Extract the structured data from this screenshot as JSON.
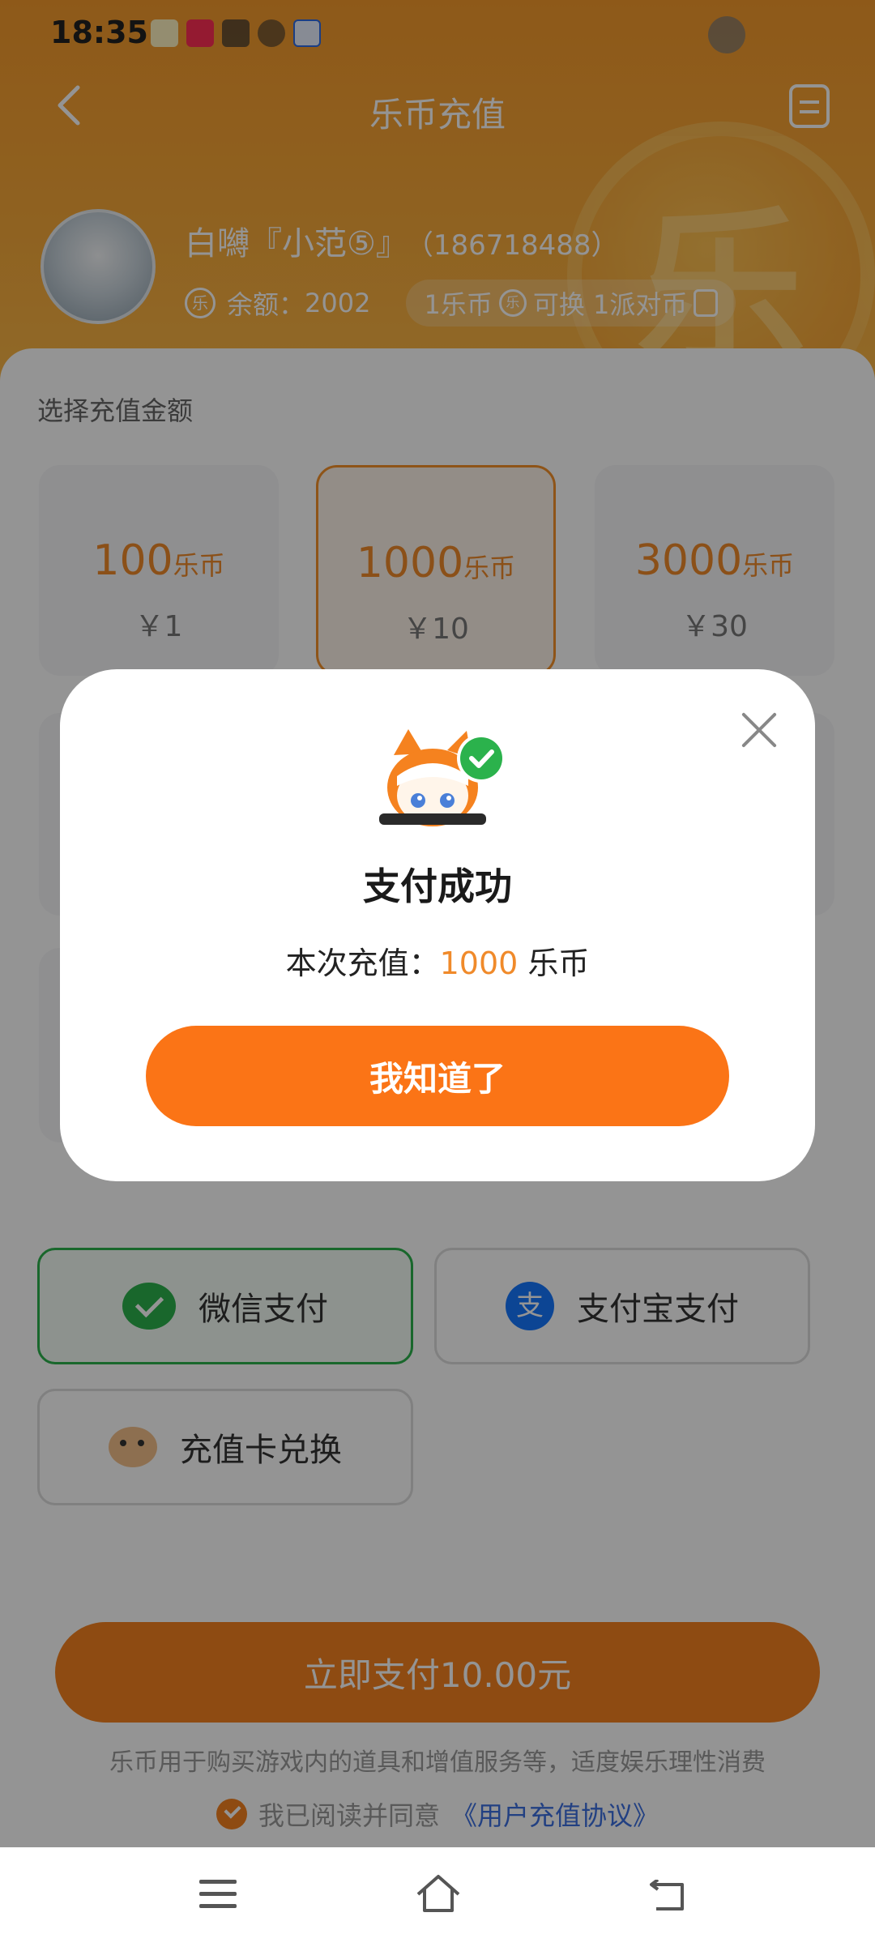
{
  "status_bar": {
    "time": "18:35",
    "app_icons": [
      "app-icon-1",
      "xiaohongshu-icon",
      "wallet-icon",
      "link-icon",
      "baidu-icon"
    ]
  },
  "header": {
    "title": "乐币充值",
    "coin_glyph": "乐",
    "username": "白嚩『小范⑤』",
    "user_id": "（186718488）",
    "balance_label": "余额：",
    "balance_value": "2002",
    "rate_text_a": "1乐币",
    "rate_text_b": "可换 1派对币",
    "colors": {
      "accent": "#f5912a",
      "pay_green": "#2bb24c",
      "alipay_blue": "#1677ff",
      "button_orange": "#fb7416"
    }
  },
  "recharge": {
    "section_label": "选择充值金额",
    "unit": "乐币",
    "options": [
      {
        "coins": "100",
        "price": "￥1"
      },
      {
        "coins": "1000",
        "price": "￥10",
        "selected": true
      },
      {
        "coins": "3000",
        "price": "￥30"
      }
    ]
  },
  "payment": {
    "wechat": "微信支付",
    "alipay": "支付宝支付",
    "alipay_glyph": "支",
    "card": "充值卡兑换"
  },
  "footer": {
    "pay_button": "立即支付10.00元",
    "notice": "乐币用于购买游戏内的道具和增值服务等，适度娱乐理性消费",
    "agree_text": "我已阅读并同意",
    "agreement_link": "《用户充值协议》"
  },
  "dialog": {
    "title": "支付成功",
    "msg_prefix": "本次充值：",
    "msg_amount": "1000",
    "msg_unit": " 乐币",
    "ok_button": "我知道了"
  }
}
